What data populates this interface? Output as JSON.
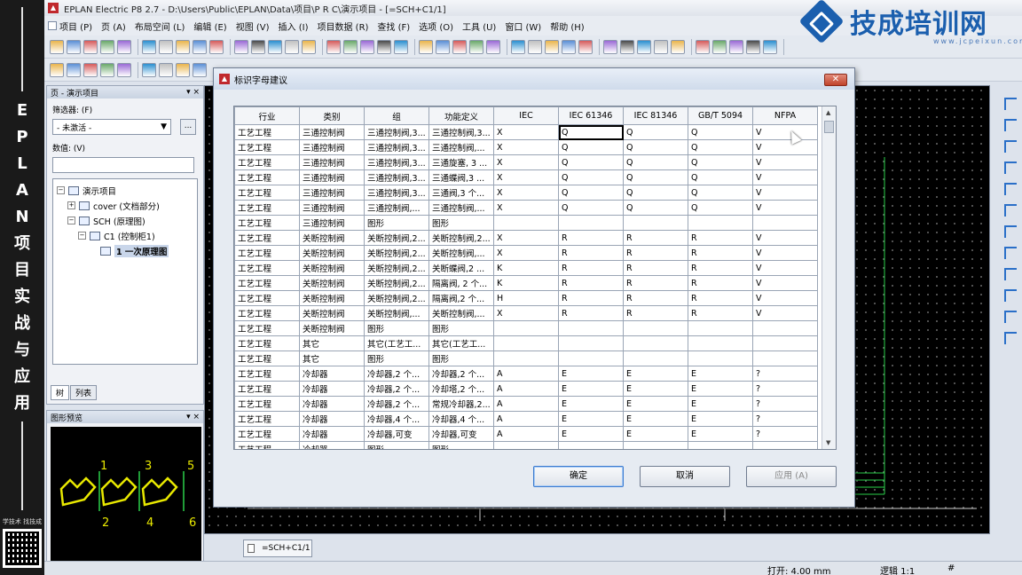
{
  "window": {
    "title": "EPLAN Electric P8 2.7 - D:\\Users\\Public\\EPLAN\\Data\\项目\\P R C\\演示项目 - [=SCH+C1/1]"
  },
  "menu": [
    "项目 (P)",
    "页 (A)",
    "布局空间 (L)",
    "编辑 (E)",
    "视图 (V)",
    "插入 (I)",
    "项目数据 (R)",
    "查找 (F)",
    "选项 (O)",
    "工具 (U)",
    "窗口 (W)",
    "帮助 (H)"
  ],
  "watermark": {
    "text": "技成培训网",
    "sub": "www.jcpeixun.com"
  },
  "promo": {
    "vertical_text": [
      "E",
      "P",
      "L",
      "A",
      "N",
      "项",
      "目",
      "实",
      "战",
      "与",
      "应",
      "用"
    ],
    "qr_label": "学技术 找技成"
  },
  "page_panel": {
    "title": "页 - 演示项目",
    "filter_label": "筛选器: (F)",
    "filter_value": "- 未激活 -",
    "filter_button": "...",
    "value_label": "数值: (V)",
    "tree": [
      {
        "label": "演示项目",
        "expander": "−"
      },
      {
        "label": "cover (文档部分)",
        "expander": "+"
      },
      {
        "label": "SCH (原理图)",
        "expander": "−"
      },
      {
        "label": "C1 (控制柜1)",
        "expander": "−"
      },
      {
        "label": "1 一次原理图",
        "expander": ""
      }
    ],
    "tabs": [
      "树",
      "列表"
    ]
  },
  "preview_panel": {
    "title": "图形预览",
    "labels": [
      "1",
      "2",
      "3",
      "4",
      "5",
      "6"
    ]
  },
  "drawing_tab": "=SCH+C1/1",
  "status": {
    "open": "打开: 4.00 mm",
    "logic": "逻辑 1:1",
    "hash": "#"
  },
  "dialog": {
    "title": "标识字母建议",
    "close": "✕",
    "columns": [
      "行业",
      "类别",
      "组",
      "功能定义",
      "IEC",
      "IEC 61346",
      "IEC 81346",
      "GB/T 5094",
      "NFPA"
    ],
    "rows": [
      [
        "工艺工程",
        "三通控制阀",
        "三通控制阀,3...",
        "三通控制阀,3...",
        "X",
        "Q",
        "Q",
        "Q",
        "V"
      ],
      [
        "工艺工程",
        "三通控制阀",
        "三通控制阀,3...",
        "三通控制阀,...",
        "X",
        "Q",
        "Q",
        "Q",
        "V"
      ],
      [
        "工艺工程",
        "三通控制阀",
        "三通控制阀,3...",
        "三通旋塞, 3 ...",
        "X",
        "Q",
        "Q",
        "Q",
        "V"
      ],
      [
        "工艺工程",
        "三通控制阀",
        "三通控制阀,3...",
        "三通蝶阀,3 ...",
        "X",
        "Q",
        "Q",
        "Q",
        "V"
      ],
      [
        "工艺工程",
        "三通控制阀",
        "三通控制阀,3...",
        "三通阀,3 个...",
        "X",
        "Q",
        "Q",
        "Q",
        "V"
      ],
      [
        "工艺工程",
        "三通控制阀",
        "三通控制阀,...",
        "三通控制阀,...",
        "X",
        "Q",
        "Q",
        "Q",
        "V"
      ],
      [
        "工艺工程",
        "三通控制阀",
        "图形",
        "图形",
        "",
        "",
        "",
        "",
        ""
      ],
      [
        "工艺工程",
        "关断控制阀",
        "关断控制阀,2...",
        "关断控制阀,2...",
        "X",
        "R",
        "R",
        "R",
        "V"
      ],
      [
        "工艺工程",
        "关断控制阀",
        "关断控制阀,2...",
        "关断控制阀,...",
        "X",
        "R",
        "R",
        "R",
        "V"
      ],
      [
        "工艺工程",
        "关断控制阀",
        "关断控制阀,2...",
        "关断蝶阀,2 ...",
        "K",
        "R",
        "R",
        "R",
        "V"
      ],
      [
        "工艺工程",
        "关断控制阀",
        "关断控制阀,2...",
        "隔离阀, 2 个...",
        "K",
        "R",
        "R",
        "R",
        "V"
      ],
      [
        "工艺工程",
        "关断控制阀",
        "关断控制阀,2...",
        "隔离阀,2 个...",
        "H",
        "R",
        "R",
        "R",
        "V"
      ],
      [
        "工艺工程",
        "关断控制阀",
        "关断控制阀,...",
        "关断控制阀,...",
        "X",
        "R",
        "R",
        "R",
        "V"
      ],
      [
        "工艺工程",
        "关断控制阀",
        "图形",
        "图形",
        "",
        "",
        "",
        "",
        ""
      ],
      [
        "工艺工程",
        "其它",
        "其它(工艺工...",
        "其它(工艺工...",
        "",
        "",
        "",
        "",
        ""
      ],
      [
        "工艺工程",
        "其它",
        "图形",
        "图形",
        "",
        "",
        "",
        "",
        ""
      ],
      [
        "工艺工程",
        "冷却器",
        "冷却器,2 个...",
        "冷却器,2 个...",
        "A",
        "E",
        "E",
        "E",
        "?"
      ],
      [
        "工艺工程",
        "冷却器",
        "冷却器,2 个...",
        "冷却塔,2 个...",
        "A",
        "E",
        "E",
        "E",
        "?"
      ],
      [
        "工艺工程",
        "冷却器",
        "冷却器,2 个...",
        "常规冷却器,2...",
        "A",
        "E",
        "E",
        "E",
        "?"
      ],
      [
        "工艺工程",
        "冷却器",
        "冷却器,4 个...",
        "冷却器,4 个...",
        "A",
        "E",
        "E",
        "E",
        "?"
      ],
      [
        "工艺工程",
        "冷却器",
        "冷却器,可变",
        "冷却器,可变",
        "A",
        "E",
        "E",
        "E",
        "?"
      ],
      [
        "工艺工程",
        "冷却器",
        "图形",
        "图形",
        "",
        "",
        "",
        "",
        ""
      ]
    ],
    "buttons": {
      "ok": "确定",
      "cancel": "取消",
      "apply": "应用 (A)"
    }
  }
}
